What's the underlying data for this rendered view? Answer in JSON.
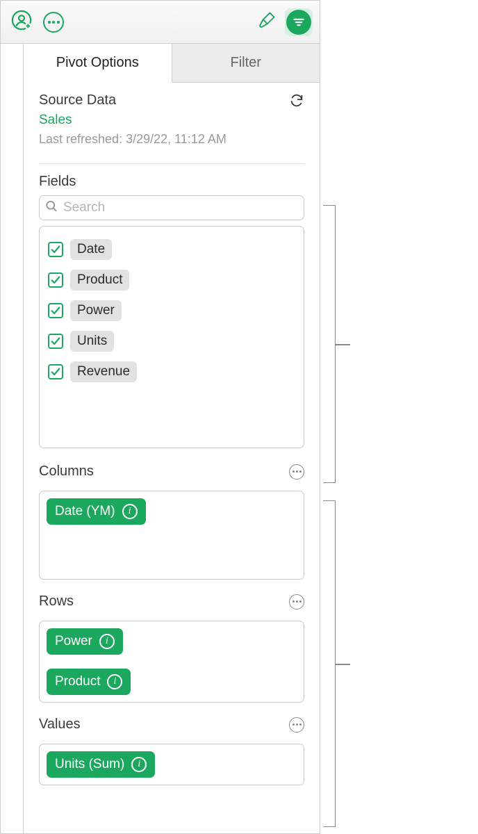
{
  "tabs": {
    "pivot": "Pivot Options",
    "filter": "Filter"
  },
  "source": {
    "heading": "Source Data",
    "name": "Sales",
    "last_refreshed": "Last refreshed: 3/29/22, 11:12 AM"
  },
  "fields": {
    "heading": "Fields",
    "search_placeholder": "Search",
    "items": [
      "Date",
      "Product",
      "Power",
      "Units",
      "Revenue"
    ]
  },
  "columns": {
    "heading": "Columns",
    "items": [
      "Date (YM)"
    ]
  },
  "rows": {
    "heading": "Rows",
    "items": [
      "Power",
      "Product"
    ]
  },
  "values": {
    "heading": "Values",
    "items": [
      "Units (Sum)"
    ]
  }
}
